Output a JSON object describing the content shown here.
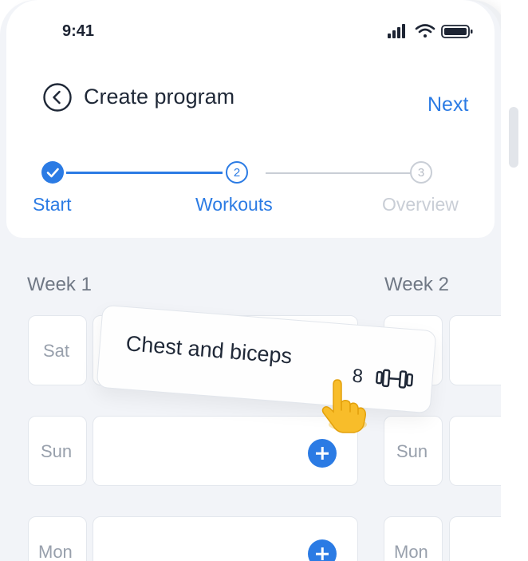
{
  "status_bar": {
    "time": "9:41"
  },
  "header": {
    "title": "Create program",
    "next_label": "Next"
  },
  "stepper": {
    "steps": [
      {
        "label": "Start",
        "number": "",
        "state": "complete"
      },
      {
        "label": "Workouts",
        "number": "2",
        "state": "current"
      },
      {
        "label": "Overview",
        "number": "3",
        "state": "upcoming"
      }
    ]
  },
  "weeks": [
    {
      "label": "Week 1",
      "days": [
        "Sat",
        "Sun",
        "Mon"
      ]
    },
    {
      "label": "Week 2",
      "days": [
        "Sun",
        "Mon"
      ]
    }
  ],
  "dragged_card": {
    "title": "Chest and biceps",
    "count": "8",
    "icon": "dumbbell-icon"
  },
  "colors": {
    "accent": "#2b7be4",
    "muted": "#c4cad3",
    "text": "#1f2837"
  }
}
